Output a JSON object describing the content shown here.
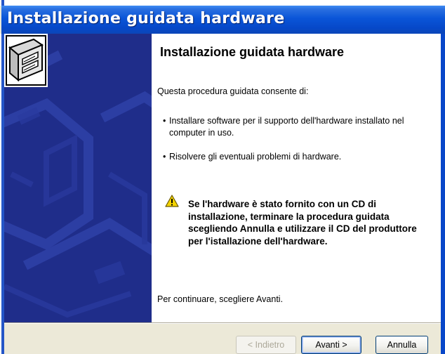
{
  "window": {
    "title": "Installazione guidata hardware"
  },
  "content": {
    "heading": "Installazione guidata hardware",
    "intro": "Questa procedura guidata consente di:",
    "bullets": [
      "Installare software per il supporto dell'hardware installato nel computer in uso.",
      "Risolvere gli eventuali problemi di hardware."
    ],
    "bullet_symbol": "•",
    "warning": "Se l'hardware è stato fornito con un CD di installazione, terminare la procedura guidata scegliendo Annulla e utilizzare il CD del produttore per l'istallazione dell'hardware.",
    "continue_text": "Per continuare, scegliere Avanti."
  },
  "buttons": {
    "back_label": "< Indietro",
    "next_label": "Avanti >",
    "cancel_label": "Annulla"
  },
  "icons": {
    "wizard": "hardware-wizard-icon",
    "warning": "warning-icon"
  },
  "colors": {
    "titlebar": "#0a55d8",
    "side_panel": "#1f2d8a",
    "dialog_bg": "#ece9d8",
    "warning_yellow": "#f5d400"
  }
}
